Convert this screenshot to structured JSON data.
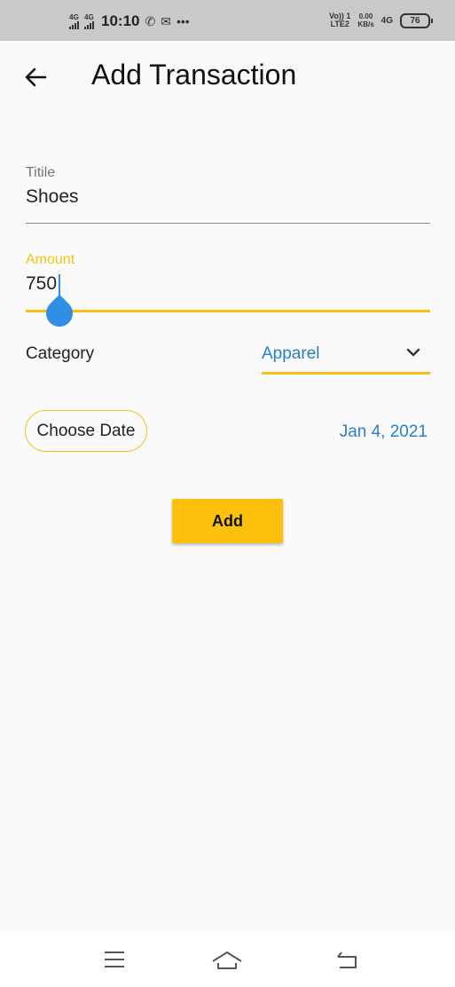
{
  "status_bar": {
    "sim1_network": "4G",
    "sim2_network": "4G",
    "time": "10:10",
    "volte_top": "Vo)) 1",
    "volte_bottom": "LTE2",
    "net_speed_value": "0.00",
    "net_speed_unit": "KB/s",
    "network_type": "4G",
    "battery": "76",
    "icons": [
      "whatsapp-icon",
      "mail-icon",
      "more-icon"
    ]
  },
  "app_bar": {
    "title": "Add Transaction",
    "back_icon": "arrow-left-icon"
  },
  "form": {
    "title_label": "Titile",
    "title_value": "Shoes",
    "amount_label": "Amount",
    "amount_value": "750",
    "category_label": "Category",
    "category_value": "Apparel",
    "choose_date_label": "Choose Date",
    "date_value": "Jan 4, 2021",
    "add_label": "Add"
  },
  "colors": {
    "accent": "#f4c215",
    "link_blue": "#2a7fc4",
    "cursor_blue": "#2f8ee6",
    "button_yellow": "#fdc10d"
  },
  "nav_bar": {
    "icons": [
      "menu-icon",
      "home-icon",
      "back-icon"
    ]
  }
}
